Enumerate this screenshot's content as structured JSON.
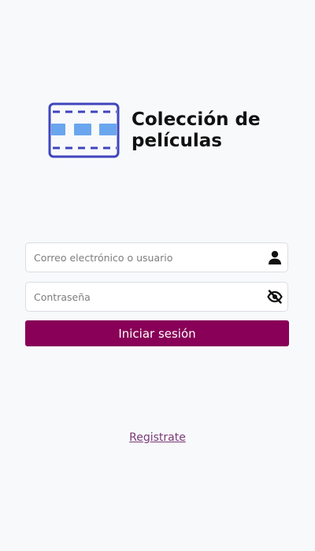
{
  "app": {
    "title": "Colección de películas",
    "logo_icon": "film-strip-icon",
    "colors": {
      "logo_stroke": "#3f45bd",
      "logo_frames": "#6aa6ee",
      "primary_button": "#880057",
      "link": "#7a3a78",
      "background": "#f8f9fb"
    }
  },
  "form": {
    "username": {
      "placeholder": "Correo electrónico o usuario",
      "value": "",
      "icon": "user-icon"
    },
    "password": {
      "placeholder": "Contraseña",
      "value": "",
      "icon": "eye-off-icon"
    },
    "login_label": "Iniciar sesión"
  },
  "footer": {
    "register_label": "Registrate"
  }
}
